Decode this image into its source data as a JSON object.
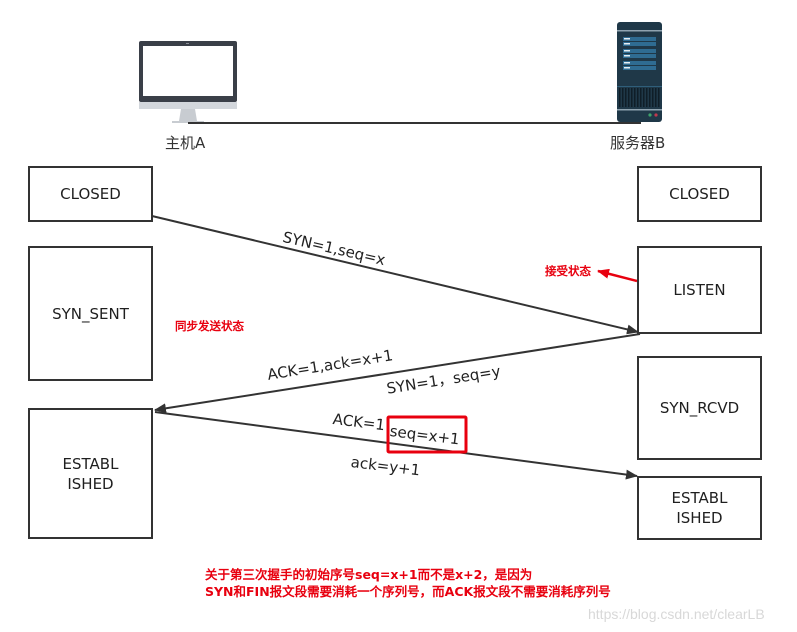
{
  "hosts": {
    "client": {
      "label": "主机A",
      "icon": "monitor-icon"
    },
    "server": {
      "label": "服务器B",
      "icon": "server-icon"
    }
  },
  "client_states": {
    "closed": "CLOSED",
    "syn_sent": "SYN_SENT",
    "established": "ESTABL\nISHED"
  },
  "server_states": {
    "closed": "CLOSED",
    "listen": "LISTEN",
    "syn_rcvd": "SYN_RCVD",
    "established": "ESTABL\nISHED"
  },
  "messages": {
    "first": "SYN=1,seq=x",
    "second_ack": "ACK=1,ack=x+1",
    "second_syn": "SYN=1，seq=y",
    "third_ack": "ACK=1",
    "third_seq": "seq=x+1",
    "third_ackno": "ack=y+1"
  },
  "annotations": {
    "listen_note": "接受状态",
    "syn_sent_note": "同步发送状态",
    "footnote_line1": "关于第三次握手的初始序号seq=x+1而不是x+2，是因为",
    "footnote_line2": "SYN和FIN报文段需要消耗一个序列号，而ACK报文段不需要消耗序列号"
  },
  "watermark": "https://blog.csdn.net/clearLB",
  "colors": {
    "line": "#333333",
    "highlight": "#e8000f",
    "monitor_frame": "#3a3f48",
    "server_body": "#1f3848"
  }
}
